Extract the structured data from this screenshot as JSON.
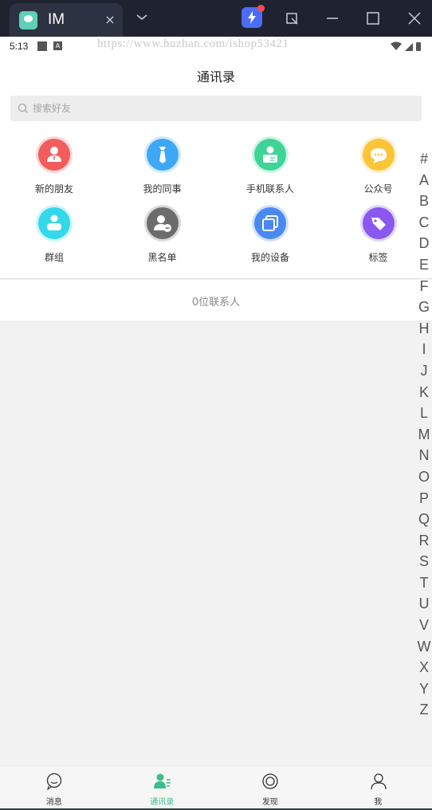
{
  "window": {
    "tab_title": "IM",
    "tab_close": "×"
  },
  "status_bar": {
    "time": "5:13",
    "badge_letter": "A",
    "watermark": "https://www.huzhan.com/ishop53421"
  },
  "header": {
    "title": "通讯录"
  },
  "search": {
    "placeholder": "搜索好友",
    "value": ""
  },
  "shortcuts": [
    {
      "label": "新的朋友",
      "icon": "new-friend-icon",
      "color": "#f25c5c"
    },
    {
      "label": "我的同事",
      "icon": "colleague-icon",
      "color": "#3fa9f5"
    },
    {
      "label": "手机联系人",
      "icon": "phone-contacts-icon",
      "color": "#3ed597"
    },
    {
      "label": "公众号",
      "icon": "official-account-icon",
      "color": "#fcc439"
    },
    {
      "label": "群组",
      "icon": "group-icon",
      "color": "#35d8ea"
    },
    {
      "label": "黑名单",
      "icon": "blacklist-icon",
      "color": "#6d6d6d"
    },
    {
      "label": "我的设备",
      "icon": "device-icon",
      "color": "#4a88f2"
    },
    {
      "label": "标签",
      "icon": "tag-icon",
      "color": "#8a58f0"
    }
  ],
  "contact_count": "0位联系人",
  "index_letters": [
    "#",
    "A",
    "B",
    "C",
    "D",
    "E",
    "F",
    "G",
    "H",
    "I",
    "J",
    "K",
    "L",
    "M",
    "N",
    "O",
    "P",
    "Q",
    "R",
    "S",
    "T",
    "U",
    "V",
    "W",
    "X",
    "Y",
    "Z"
  ],
  "tabs": [
    {
      "label": "消息",
      "icon": "message-icon",
      "active": false
    },
    {
      "label": "通讯录",
      "icon": "contacts-icon",
      "active": true
    },
    {
      "label": "发现",
      "icon": "discover-icon",
      "active": false
    },
    {
      "label": "我",
      "icon": "profile-icon",
      "active": false
    }
  ],
  "colors": {
    "accent": "#3bbf8a",
    "chrome": "#1f2330"
  }
}
